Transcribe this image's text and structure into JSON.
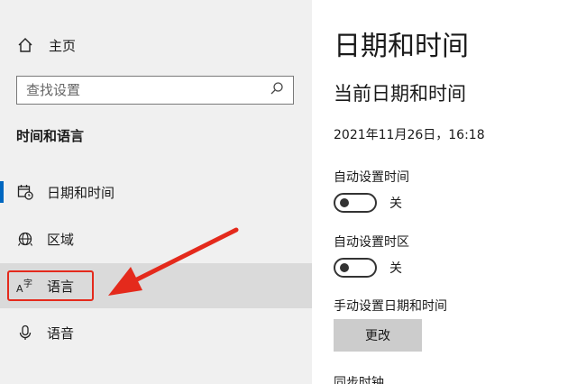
{
  "sidebar": {
    "home_label": "主页",
    "search_placeholder": "查找设置",
    "section_title": "时间和语言",
    "items": [
      {
        "label": "日期和时间",
        "icon": "calendar-clock-icon"
      },
      {
        "label": "区域",
        "icon": "globe-icon"
      },
      {
        "label": "语言",
        "icon": "language-icon"
      },
      {
        "label": "语音",
        "icon": "microphone-icon"
      }
    ]
  },
  "main": {
    "title": "日期和时间",
    "subtitle": "当前日期和时间",
    "current_datetime": "2021年11月26日，16:18",
    "auto_time_label": "自动设置时间",
    "auto_time_state": "关",
    "auto_timezone_label": "自动设置时区",
    "auto_timezone_state": "关",
    "manual_label": "手动设置日期和时间",
    "change_button": "更改",
    "cut_off_text": "同步时钟"
  },
  "colors": {
    "accent": "#0067c0",
    "annotation_red": "#e42a1c",
    "sidebar_bg": "#f0f0f0"
  }
}
